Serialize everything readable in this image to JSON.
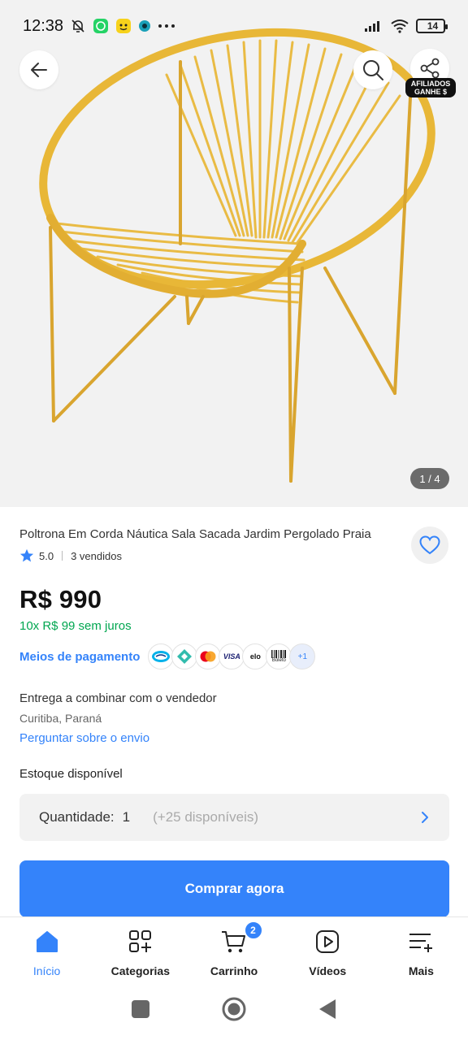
{
  "status_bar": {
    "time": "12:38",
    "battery": "14"
  },
  "gallery": {
    "counter": "1 / 4",
    "affiliate_badge_line1": "AFILIADOS",
    "affiliate_badge_line2": "GANHE $",
    "chair_color": "#e8b737"
  },
  "product": {
    "title": "Poltrona Em Corda Náutica Sala Sacada Jardim Pergolado Praia",
    "rating": "5.0",
    "sold": "3 vendidos",
    "price": "R$ 990",
    "installments": "10x R$ 99 sem juros",
    "payment_label": "Meios de pagamento",
    "payment_more": "+1",
    "payment_methods": [
      "mercado-pago",
      "pix",
      "mastercard",
      "visa",
      "elo",
      "boleto"
    ],
    "visa_label": "VISA",
    "elo_label": "elo",
    "boleto_label": "Boleto"
  },
  "delivery": {
    "text": "Entrega a combinar com o vendedor",
    "location": "Curitiba, Paraná",
    "ask_link": "Perguntar sobre o envio"
  },
  "stock": {
    "title": "Estoque disponível",
    "quantity_label": "Quantidade:",
    "quantity_value": "1",
    "available": "(+25 disponíveis)"
  },
  "buy_button": "Comprar agora",
  "bottom_nav": {
    "items": [
      {
        "label": "Início",
        "icon": "home-icon"
      },
      {
        "label": "Categorias",
        "icon": "categories-icon"
      },
      {
        "label": "Carrinho",
        "icon": "cart-icon"
      },
      {
        "label": "Vídeos",
        "icon": "video-icon"
      },
      {
        "label": "Mais",
        "icon": "menu-plus-icon"
      }
    ],
    "cart_badge": "2"
  },
  "colors": {
    "accent": "#3483fa",
    "installments": "#00a650"
  }
}
